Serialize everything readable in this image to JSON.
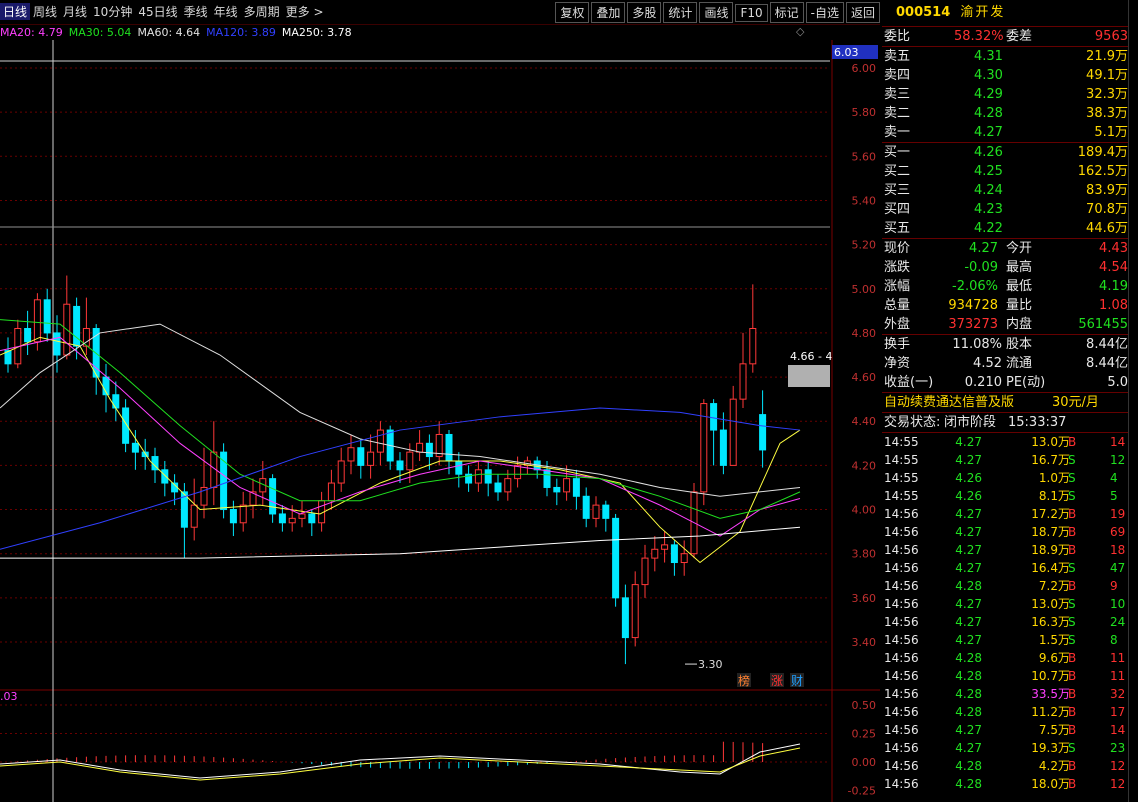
{
  "toolbar": {
    "periods": [
      "日线",
      "周线",
      "月线",
      "10分钟",
      "45日线",
      "季线",
      "年线",
      "多周期",
      "更多 >"
    ],
    "active_period": "日线",
    "tools": [
      "复权",
      "叠加",
      "多股",
      "统计",
      "画线",
      "F10",
      "标记",
      "-自选",
      "返回"
    ]
  },
  "ma_legend": [
    {
      "label": "MA20: 4.79",
      "color": "#ff40ff"
    },
    {
      "label": "MA30: 5.04",
      "color": "#20e020"
    },
    {
      "label": "MA60: 4.64",
      "color": "#e0e0e0"
    },
    {
      "label": "MA120: 3.89",
      "color": "#3040ff"
    },
    {
      "label": "MA250: 3.78",
      "color": "#ffffff"
    }
  ],
  "chart": {
    "price_axis": [
      "6.00",
      "5.80",
      "5.60",
      "5.40",
      "5.20",
      "5.00",
      "4.80",
      "4.60",
      "4.40",
      "4.20",
      "4.00",
      "3.80",
      "3.60",
      "3.40"
    ],
    "cursor_price": "6.03",
    "low_label": "3.30",
    "range_label": "4.66 - 4",
    "markers": [
      {
        "text": "榜",
        "color": "#ff8030"
      },
      {
        "text": "涨",
        "color": "#ff3030"
      },
      {
        "text": "财",
        "color": "#20a0ff"
      }
    ],
    "indicator_value": ".03",
    "indicator_axis": [
      "0.50",
      "0.25",
      "0.00"
    ],
    "indicator_neg": "-0.25"
  },
  "quote": {
    "code": "000514",
    "name": "渝开发",
    "weibi_label": "委比",
    "weibi": "58.32%",
    "weicha_label": "委差",
    "weicha": "9563",
    "asks": [
      {
        "label": "卖五",
        "price": "4.31",
        "vol": "21.9万"
      },
      {
        "label": "卖四",
        "price": "4.30",
        "vol": "49.1万"
      },
      {
        "label": "卖三",
        "price": "4.29",
        "vol": "32.3万"
      },
      {
        "label": "卖二",
        "price": "4.28",
        "vol": "38.3万"
      },
      {
        "label": "卖一",
        "price": "4.27",
        "vol": "5.1万"
      }
    ],
    "bids": [
      {
        "label": "买一",
        "price": "4.26",
        "vol": "189.4万"
      },
      {
        "label": "买二",
        "price": "4.25",
        "vol": "162.5万"
      },
      {
        "label": "买三",
        "price": "4.24",
        "vol": "83.9万"
      },
      {
        "label": "买四",
        "price": "4.23",
        "vol": "70.8万"
      },
      {
        "label": "买五",
        "price": "4.22",
        "vol": "44.6万"
      }
    ],
    "stats": [
      {
        "l1": "现价",
        "v1": "4.27",
        "c1": "green",
        "l2": "今开",
        "v2": "4.43",
        "c2": "red"
      },
      {
        "l1": "涨跌",
        "v1": "-0.09",
        "c1": "green",
        "l2": "最高",
        "v2": "4.54",
        "c2": "red"
      },
      {
        "l1": "涨幅",
        "v1": "-2.06%",
        "c1": "green",
        "l2": "最低",
        "v2": "4.19",
        "c2": "green"
      },
      {
        "l1": "总量",
        "v1": "934728",
        "c1": "yellow",
        "l2": "量比",
        "v2": "1.08",
        "c2": "red"
      },
      {
        "l1": "外盘",
        "v1": "373273",
        "c1": "red",
        "l2": "内盘",
        "v2": "561455",
        "c2": "green"
      }
    ],
    "fund": [
      {
        "l1": "换手",
        "v1": "11.08%",
        "l2": "股本",
        "v2": "8.44亿"
      },
      {
        "l1": "净资",
        "v1": "4.52",
        "l2": "流通",
        "v2": "8.44亿"
      },
      {
        "l1": "收益(一)",
        "v1": "0.210",
        "l2": "PE(动)",
        "v2": "5.0"
      }
    ],
    "ad_text": "自动续费通达信普及版",
    "ad_price": "30元/月",
    "status_label": "交易状态:",
    "status": "闭市阶段",
    "time": "15:33:37"
  },
  "ticks": [
    {
      "t": "14:55",
      "p": "4.27",
      "v": "13.0万",
      "d": "B",
      "n": "14"
    },
    {
      "t": "14:55",
      "p": "4.27",
      "v": "16.7万",
      "d": "S",
      "n": "12"
    },
    {
      "t": "14:55",
      "p": "4.26",
      "v": "1.0万",
      "d": "S",
      "n": "4"
    },
    {
      "t": "14:55",
      "p": "4.26",
      "v": "8.1万",
      "d": "S",
      "n": "5"
    },
    {
      "t": "14:56",
      "p": "4.27",
      "v": "17.2万",
      "d": "B",
      "n": "19"
    },
    {
      "t": "14:56",
      "p": "4.27",
      "v": "18.7万",
      "d": "B",
      "n": "69"
    },
    {
      "t": "14:56",
      "p": "4.27",
      "v": "18.9万",
      "d": "B",
      "n": "18"
    },
    {
      "t": "14:56",
      "p": "4.27",
      "v": "16.4万",
      "d": "S",
      "n": "47"
    },
    {
      "t": "14:56",
      "p": "4.28",
      "v": "7.2万",
      "d": "B",
      "n": "9"
    },
    {
      "t": "14:56",
      "p": "4.27",
      "v": "13.0万",
      "d": "S",
      "n": "10"
    },
    {
      "t": "14:56",
      "p": "4.27",
      "v": "16.3万",
      "d": "S",
      "n": "24"
    },
    {
      "t": "14:56",
      "p": "4.27",
      "v": "1.5万",
      "d": "S",
      "n": "8"
    },
    {
      "t": "14:56",
      "p": "4.28",
      "v": "9.6万",
      "d": "B",
      "n": "11"
    },
    {
      "t": "14:56",
      "p": "4.28",
      "v": "10.7万",
      "d": "B",
      "n": "11"
    },
    {
      "t": "14:56",
      "p": "4.28",
      "v": "33.5万",
      "d": "B",
      "n": "32"
    },
    {
      "t": "14:56",
      "p": "4.28",
      "v": "11.2万",
      "d": "B",
      "n": "17"
    },
    {
      "t": "14:56",
      "p": "4.27",
      "v": "7.5万",
      "d": "B",
      "n": "14"
    },
    {
      "t": "14:56",
      "p": "4.27",
      "v": "19.3万",
      "d": "S",
      "n": "23"
    },
    {
      "t": "14:56",
      "p": "4.28",
      "v": "4.2万",
      "d": "B",
      "n": "12"
    },
    {
      "t": "14:56",
      "p": "4.28",
      "v": "18.0万",
      "d": "B",
      "n": "12"
    }
  ]
}
